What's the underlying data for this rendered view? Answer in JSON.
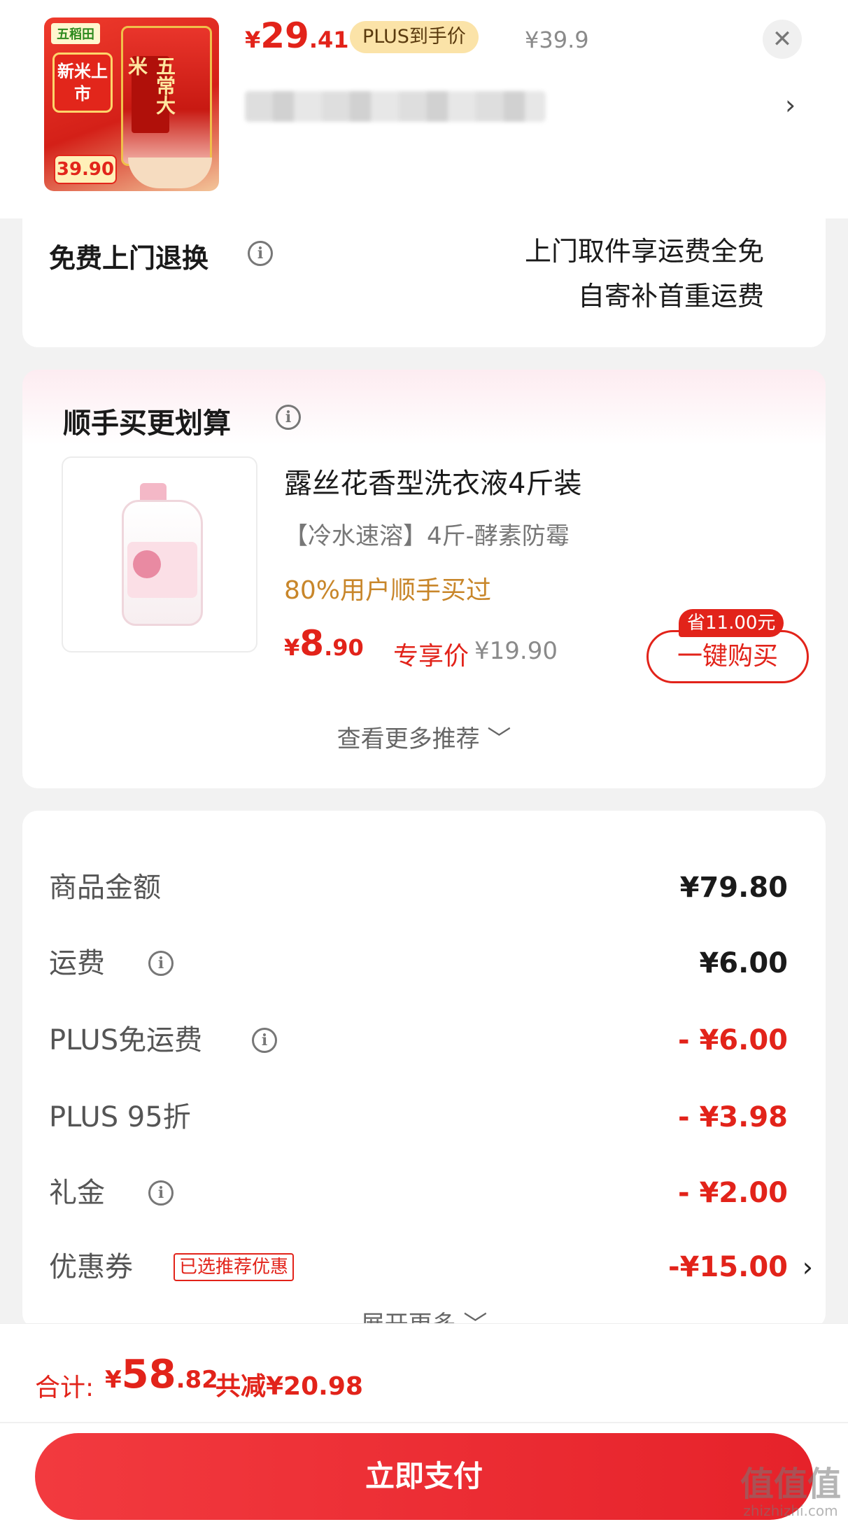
{
  "product": {
    "thumbnail": {
      "brand": "五稻田",
      "new_rice": "新米上市",
      "bag_title": "五常大米",
      "price_chip": "39.90"
    },
    "price_currency": "¥",
    "price_int": "29",
    "price_dec": ".41",
    "plus_badge": "PLUS到手价",
    "original_price": "¥39.9",
    "close_label": "✕",
    "address_chevron": "›"
  },
  "return_service": {
    "title": "免费上门退换",
    "line1": "上门取件享运费全免",
    "line2": "自寄补首重运费"
  },
  "recommendation": {
    "title": "顺手买更划算",
    "item_name": "露丝花香型洗衣液4斤装",
    "item_sub": "【冷水速溶】4斤-酵素防霉",
    "social_proof": "80%用户顺手买过",
    "price_currency": "¥",
    "price_int": "8",
    "price_dec": ".90",
    "exclusive_label": "专享价",
    "original_price": "¥19.90",
    "save_chip": "省11.00元",
    "buy_button": "一键购买",
    "more_label": "查看更多推荐 ﹀"
  },
  "summary": {
    "rows": [
      {
        "label": "商品金额",
        "value": "¥79.80"
      },
      {
        "label": "运费",
        "value": "¥6.00"
      },
      {
        "label": "PLUS免运费",
        "value": "- ¥6.00"
      },
      {
        "label": "PLUS 95折",
        "value": "- ¥3.98"
      },
      {
        "label": "礼金",
        "value": "- ¥2.00"
      },
      {
        "label": "优惠券",
        "value": "-¥15.00",
        "tag": "已选推荐优惠",
        "chevron": "›"
      }
    ],
    "expand_label": "展开更多 ﹀"
  },
  "footer": {
    "total_label": "合计:",
    "total_currency": "¥",
    "total_int": "58",
    "total_dec": ".82",
    "saved": "共减¥20.98",
    "pay_button": "立即支付"
  },
  "watermark": {
    "main": "值值值",
    "site": "zhizhizhi.com"
  },
  "colors": {
    "accent": "#e2231a",
    "plus_badge_bg": "#fbe3a8",
    "social_proof": "#c8862a"
  }
}
